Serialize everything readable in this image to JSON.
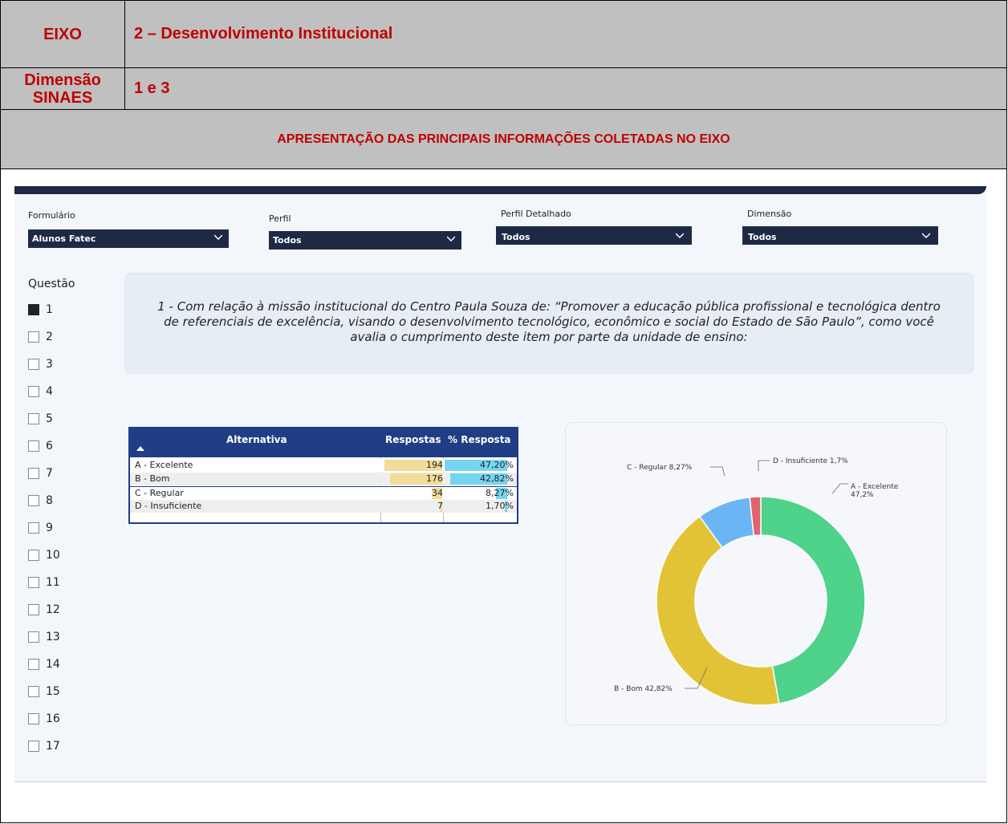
{
  "doc": {
    "eixo_label": "EIXO",
    "eixo_value": "2 – Desenvolvimento Institucional",
    "dimensao_label": "Dimensão SINAES",
    "dimensao_value": "1 e 3",
    "section_title": "APRESENTAÇÃO DAS PRINCIPAIS INFORMAÇÕES COLETADAS NO EIXO"
  },
  "filters": [
    {
      "label": "Formulário",
      "value": "Alunos Fatec"
    },
    {
      "label": "Perfil",
      "value": "Todos"
    },
    {
      "label": "Perfil Detalhado",
      "value": "Todos"
    },
    {
      "label": "Dimensão",
      "value": "Todos"
    }
  ],
  "questions": {
    "title": "Questão",
    "items": [
      "1",
      "2",
      "3",
      "4",
      "5",
      "6",
      "7",
      "8",
      "9",
      "10",
      "11",
      "12",
      "13",
      "14",
      "15",
      "16",
      "17"
    ],
    "selected": "1"
  },
  "question_text": "1 - Com relação à missão institucional do Centro Paula Souza de: “Promover a educação pública profissional e tecnológica dentro de referenciais de excelência, visando o desenvolvimento tecnológico, econômico e social do Estado de São Paulo”, como você avalia o cumprimento deste item por parte da unidade de ensino:",
  "table": {
    "headers": [
      "Alternativa",
      "Respostas",
      "% Resposta"
    ],
    "rows": [
      {
        "alt": "A - Excelente",
        "resp": "194",
        "pct": "47,20%",
        "resp_val": 194,
        "pct_val": 47.2
      },
      {
        "alt": "B - Bom",
        "resp": "176",
        "pct": "42,82%",
        "resp_val": 176,
        "pct_val": 42.82
      },
      {
        "alt": "C - Regular",
        "resp": "34",
        "pct": "8,27%",
        "resp_val": 34,
        "pct_val": 8.27
      },
      {
        "alt": "D - Insuficiente",
        "resp": "7",
        "pct": "1,70%",
        "resp_val": 7,
        "pct_val": 1.7
      }
    ]
  },
  "chart_data": {
    "type": "pie",
    "donut": true,
    "categories": [
      "A - Excelente",
      "B - Bom",
      "C - Regular",
      "D - Insuficiente"
    ],
    "values": [
      47.2,
      42.82,
      8.27,
      1.7
    ],
    "labels": [
      "A - Excelente 47,2%",
      "B - Bom 42,82%",
      "C - Regular 8,27%",
      "D - Insuficiente 1,7%"
    ],
    "colors": [
      "#4fd28a",
      "#e3c336",
      "#6ab6f5",
      "#e0646c"
    ]
  }
}
